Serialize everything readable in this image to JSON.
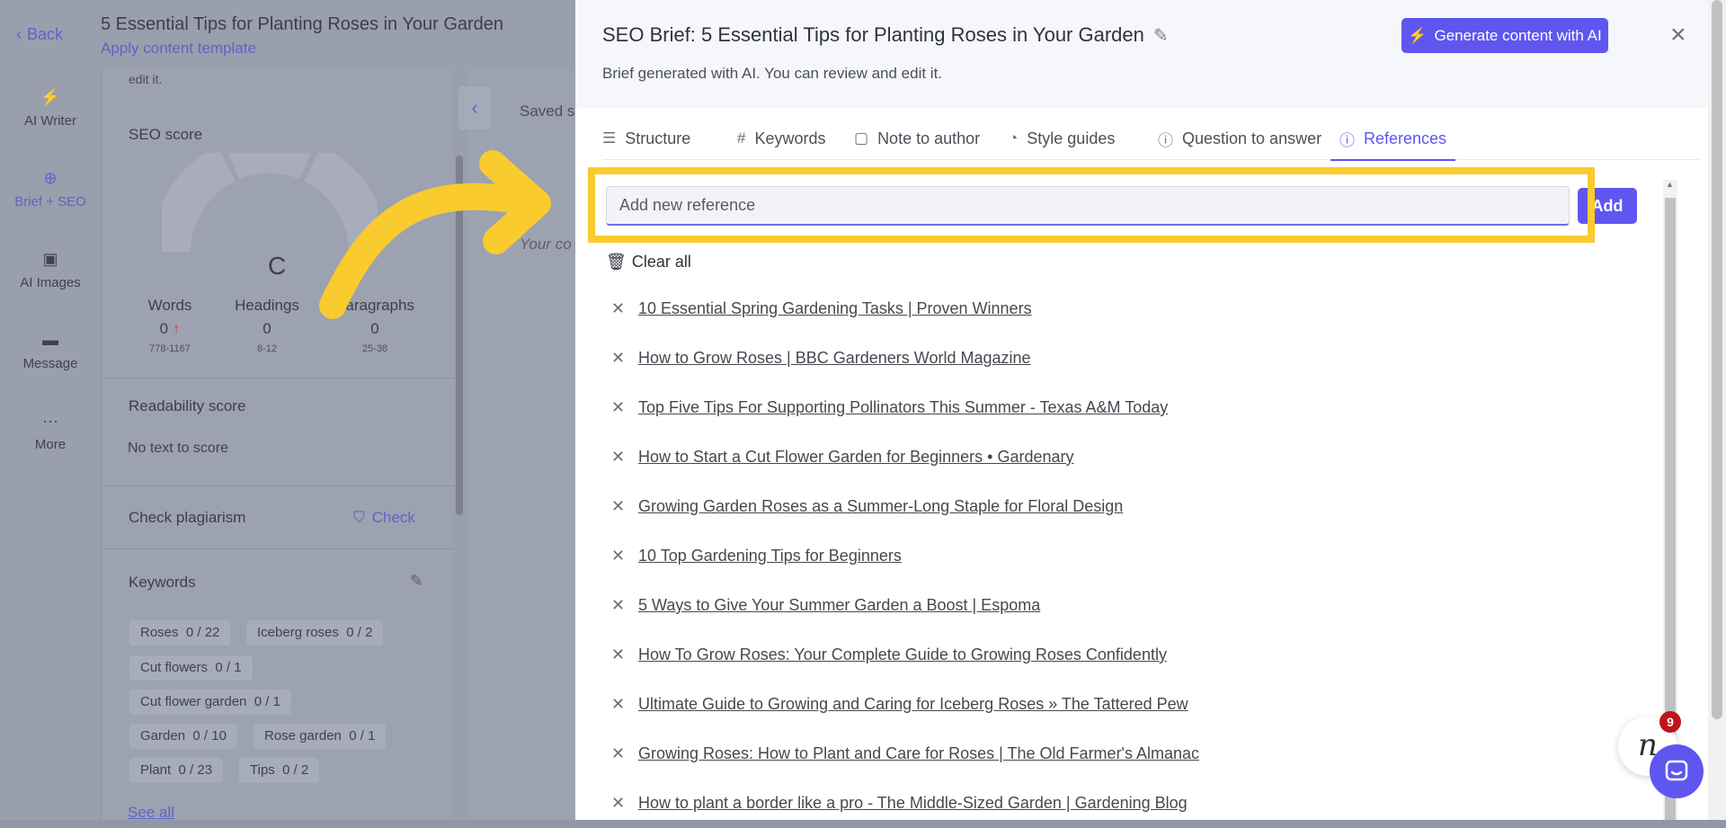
{
  "app": {
    "back_label": "Back",
    "doc_title": "5 Essential Tips for Planting Roses in Your Garden",
    "apply_template": "Apply content template"
  },
  "rail": [
    {
      "label": "AI Writer",
      "icon": "bolt-icon"
    },
    {
      "label": "Brief + SEO",
      "icon": "target-icon"
    },
    {
      "label": "AI Images",
      "icon": "image-icon"
    },
    {
      "label": "Message",
      "icon": "message-icon"
    },
    {
      "label": "More",
      "icon": "more-icon"
    }
  ],
  "panel": {
    "cut_text": "edit it.",
    "seo_title": "SEO score",
    "grade": "C",
    "stats": [
      {
        "label": "Words",
        "value": "0",
        "range": "778-1167"
      },
      {
        "label": "Headings",
        "value": "0",
        "range": "8-12"
      },
      {
        "label": "Paragraphs",
        "value": "0",
        "range": "25-38"
      }
    ],
    "readability_title": "Readability score",
    "readability_text": "No text to score",
    "plagiarism_title": "Check plagiarism",
    "check_label": "Check",
    "keywords_title": "Keywords",
    "keywords": [
      {
        "name": "Roses",
        "count": "0 / 22"
      },
      {
        "name": "Iceberg roses",
        "count": "0 / 2"
      },
      {
        "name": "Cut flowers",
        "count": "0 / 1"
      },
      {
        "name": "Cut flower garden",
        "count": "0 / 1"
      },
      {
        "name": "Garden",
        "count": "0 / 10"
      },
      {
        "name": "Rose garden",
        "count": "0 / 1"
      },
      {
        "name": "Plant",
        "count": "0 / 23"
      },
      {
        "name": "Tips",
        "count": "0 / 2"
      }
    ],
    "see_all": "See all"
  },
  "editor": {
    "saved": "Saved s",
    "placeholder": "Your co"
  },
  "modal": {
    "title": "SEO Brief: 5 Essential Tips for Planting Roses in Your Garden",
    "subtitle": "Brief generated with AI. You can review and edit it.",
    "generate_label": "Generate content with AI",
    "tabs": [
      {
        "label": "Structure",
        "icon": "list-icon"
      },
      {
        "label": "Keywords",
        "icon": "hash-icon"
      },
      {
        "label": "Note to author",
        "icon": "note-icon"
      },
      {
        "label": "Style guides",
        "icon": "palette-icon"
      },
      {
        "label": "Question to answer",
        "icon": "question-icon"
      },
      {
        "label": "References",
        "icon": "info-icon"
      }
    ],
    "active_tab": "References",
    "input_placeholder": "Add new reference",
    "add_label": "Add",
    "clear_all": "Clear all",
    "references": [
      "10 Essential Spring Gardening Tasks | Proven Winners",
      "How to Grow Roses | BBC Gardeners World Magazine",
      "Top Five Tips For Supporting Pollinators This Summer - Texas A&M Today",
      "How to Start a Cut Flower Garden for Beginners • Gardenary",
      "Growing Garden Roses as a Summer-Long Staple for Floral Design",
      "10 Top Gardening Tips for Beginners",
      "5 Ways to Give Your Summer Garden a Boost | Espoma",
      "How To Grow Roses: Your Complete Guide to Growing Roses Confidently",
      "Ultimate Guide to Growing and Caring for Iceberg Roses » The Tattered Pew",
      "Growing Roses: How to Plant and Care for Roses | The Old Farmer's Almanac",
      "How to plant a border like a pro - The Middle-Sized Garden | Gardening Blog"
    ]
  },
  "widget": {
    "badge_letter": "n",
    "notification_count": "9"
  },
  "colors": {
    "accent": "#5f56ef",
    "highlight": "#f9cb2e",
    "overlay": "#9a9fae"
  }
}
